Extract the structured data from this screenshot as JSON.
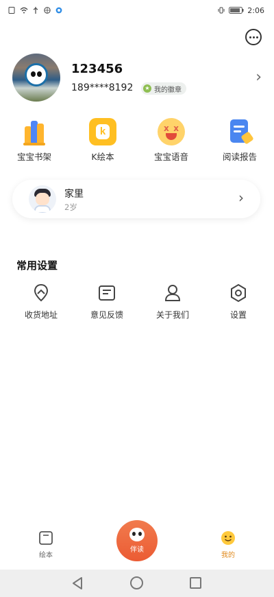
{
  "status_bar": {
    "time": "2:06"
  },
  "profile": {
    "username": "123456",
    "phone": "189****8192",
    "badge": "我的徽章"
  },
  "quick_actions": [
    {
      "label": "宝宝书架",
      "icon": "bookshelf-icon"
    },
    {
      "label": "K绘本",
      "icon": "k-picturebook-icon"
    },
    {
      "label": "宝宝语音",
      "icon": "baby-voice-icon"
    },
    {
      "label": "阅读报告",
      "icon": "reading-report-icon"
    }
  ],
  "family": {
    "name": "家里",
    "age": "2岁"
  },
  "settings": {
    "title": "常用设置",
    "items": [
      {
        "label": "收货地址",
        "icon": "location-icon"
      },
      {
        "label": "意见反馈",
        "icon": "feedback-icon"
      },
      {
        "label": "关于我们",
        "icon": "user-icon"
      },
      {
        "label": "设置",
        "icon": "settings-icon"
      }
    ]
  },
  "tabbar": {
    "tabs": [
      {
        "label": "绘本",
        "icon": "book-icon"
      },
      {
        "label": "伴读",
        "icon": "panda-icon"
      },
      {
        "label": "我的",
        "icon": "smiley-icon"
      }
    ]
  },
  "colors": {
    "accent": "#eb5b33",
    "active_tab": "#e08a1e"
  }
}
